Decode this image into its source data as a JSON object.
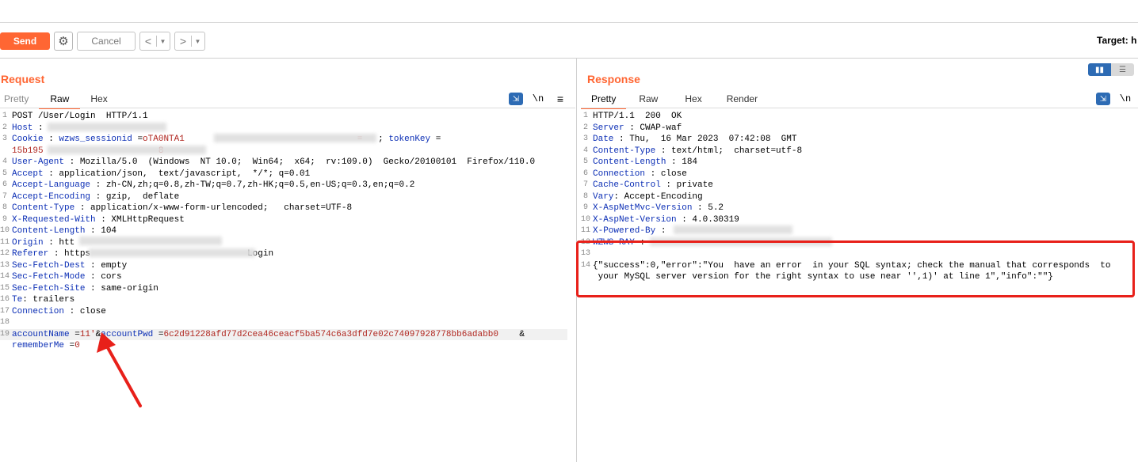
{
  "toolbar": {
    "send_label": "Send",
    "cancel_label": "Cancel",
    "target_label": "Target: h"
  },
  "request": {
    "title": "Request",
    "tabs": [
      "Pretty",
      "Raw",
      "Hex"
    ],
    "lines": [
      {
        "n": "1",
        "segs": [
          {
            "t": "POST /User/Login  HTTP/1.1",
            "c": "hval"
          }
        ]
      },
      {
        "n": "2",
        "segs": [
          {
            "t": "Host",
            "c": "hname"
          },
          {
            "t": " : ",
            "c": "hval"
          }
        ]
      },
      {
        "n": "3",
        "segs": [
          {
            "t": "Cookie",
            "c": "hname"
          },
          {
            "t": " : ",
            "c": "hval"
          },
          {
            "t": "wzws_sessionid",
            "c": "hname"
          },
          {
            "t": " =",
            "c": "hval"
          },
          {
            "t": "oTA0NTA1",
            "c": "param-val"
          },
          {
            "t": "                                 ",
            "c": "hval"
          },
          {
            "t": "=",
            "c": "param-val"
          },
          {
            "t": "   ; ",
            "c": "hval"
          },
          {
            "t": "tokenKey",
            "c": "hname"
          },
          {
            "t": " =",
            "c": "hval"
          }
        ]
      },
      {
        "n": "",
        "segs": [
          {
            "t": "15b195",
            "c": "param-val"
          },
          {
            "t": "                      ",
            "c": "hval"
          },
          {
            "t": "8",
            "c": "param-val"
          }
        ]
      },
      {
        "n": "4",
        "segs": [
          {
            "t": "User-Agent",
            "c": "hname"
          },
          {
            "t": " : Mozilla/5.0  (Windows  NT 10.0;  Win64;  x64;  rv:109.0)  Gecko/20100101  Firefox/110.0",
            "c": "hval"
          }
        ]
      },
      {
        "n": "5",
        "segs": [
          {
            "t": "Accept",
            "c": "hname"
          },
          {
            "t": " : application/json,  text/javascript,  */*; q=0.01",
            "c": "hval"
          }
        ]
      },
      {
        "n": "6",
        "segs": [
          {
            "t": "Accept-Language",
            "c": "hname"
          },
          {
            "t": " : zh-CN,zh;q=0.8,zh-TW;q=0.7,zh-HK;q=0.5,en-US;q=0.3,en;q=0.2",
            "c": "hval"
          }
        ]
      },
      {
        "n": "7",
        "segs": [
          {
            "t": "Accept-Encoding",
            "c": "hname"
          },
          {
            "t": " : gzip,  deflate",
            "c": "hval"
          }
        ]
      },
      {
        "n": "8",
        "segs": [
          {
            "t": "Content-Type",
            "c": "hname"
          },
          {
            "t": " : application/x-www-form-urlencoded;   charset=UTF-8",
            "c": "hval"
          }
        ]
      },
      {
        "n": "9",
        "segs": [
          {
            "t": "X-Requested-With",
            "c": "hname"
          },
          {
            "t": " : XMLHttpRequest",
            "c": "hval"
          }
        ]
      },
      {
        "n": "10",
        "segs": [
          {
            "t": "Content-Length",
            "c": "hname"
          },
          {
            "t": " : 104",
            "c": "hval"
          }
        ]
      },
      {
        "n": "11",
        "segs": [
          {
            "t": "Origin",
            "c": "hname"
          },
          {
            "t": " : htt",
            "c": "hval"
          }
        ]
      },
      {
        "n": "12",
        "segs": [
          {
            "t": "Referer",
            "c": "hname"
          },
          {
            "t": " : https",
            "c": "hval"
          },
          {
            "t": "                              ",
            "c": "hval"
          },
          {
            "t": "Login",
            "c": "hval"
          }
        ]
      },
      {
        "n": "13",
        "segs": [
          {
            "t": "Sec-Fetch-Dest",
            "c": "hname"
          },
          {
            "t": " : empty",
            "c": "hval"
          }
        ]
      },
      {
        "n": "14",
        "segs": [
          {
            "t": "Sec-Fetch-Mode",
            "c": "hname"
          },
          {
            "t": " : cors",
            "c": "hval"
          }
        ]
      },
      {
        "n": "15",
        "segs": [
          {
            "t": "Sec-Fetch-Site",
            "c": "hname"
          },
          {
            "t": " : same-origin",
            "c": "hval"
          }
        ]
      },
      {
        "n": "16",
        "segs": [
          {
            "t": "Te",
            "c": "hname"
          },
          {
            "t": ": trailers",
            "c": "hval"
          }
        ]
      },
      {
        "n": "17",
        "segs": [
          {
            "t": "Connection",
            "c": "hname"
          },
          {
            "t": " : close",
            "c": "hval"
          }
        ]
      },
      {
        "n": "18",
        "segs": []
      },
      {
        "n": "19",
        "hl": true,
        "segs": [
          {
            "t": "accountName",
            "c": "param-name"
          },
          {
            "t": " =",
            "c": "hval"
          },
          {
            "t": "11'",
            "c": "param-val"
          },
          {
            "t": "&",
            "c": "hval"
          },
          {
            "t": "accountPwd",
            "c": "param-name"
          },
          {
            "t": " =",
            "c": "hval"
          },
          {
            "t": "6c2d91228afd77d2cea46ceacf5ba574c6a3dfd7e02c74097928778bb6adabb0",
            "c": "param-val"
          },
          {
            "t": "    &",
            "c": "hval"
          }
        ]
      },
      {
        "n": "",
        "segs": [
          {
            "t": "rememberMe",
            "c": "param-name"
          },
          {
            "t": " =",
            "c": "hval"
          },
          {
            "t": "0",
            "c": "param-val"
          }
        ]
      }
    ]
  },
  "response": {
    "title": "Response",
    "tabs": [
      "Pretty",
      "Raw",
      "Hex",
      "Render"
    ],
    "lines": [
      {
        "n": "1",
        "segs": [
          {
            "t": "HTTP/1.1  200  OK",
            "c": "hval"
          }
        ]
      },
      {
        "n": "2",
        "segs": [
          {
            "t": "Server",
            "c": "hname"
          },
          {
            "t": " : CWAP-waf",
            "c": "hval"
          }
        ]
      },
      {
        "n": "3",
        "segs": [
          {
            "t": "Date",
            "c": "hname"
          },
          {
            "t": " : Thu,  16 Mar 2023  07:42:08  GMT",
            "c": "hval"
          }
        ]
      },
      {
        "n": "4",
        "segs": [
          {
            "t": "Content-Type",
            "c": "hname"
          },
          {
            "t": " : text/html;  charset=utf-8",
            "c": "hval"
          }
        ]
      },
      {
        "n": "5",
        "segs": [
          {
            "t": "Content-Length",
            "c": "hname"
          },
          {
            "t": " : 184",
            "c": "hval"
          }
        ]
      },
      {
        "n": "6",
        "segs": [
          {
            "t": "Connection",
            "c": "hname"
          },
          {
            "t": " : close",
            "c": "hval"
          }
        ]
      },
      {
        "n": "7",
        "segs": [
          {
            "t": "Cache-Control",
            "c": "hname"
          },
          {
            "t": " : private",
            "c": "hval"
          }
        ]
      },
      {
        "n": "8",
        "segs": [
          {
            "t": "Vary",
            "c": "hname"
          },
          {
            "t": ": Accept-Encoding",
            "c": "hval"
          }
        ]
      },
      {
        "n": "9",
        "segs": [
          {
            "t": "X-AspNetMvc-Version",
            "c": "hname"
          },
          {
            "t": " : 5.2",
            "c": "hval"
          }
        ]
      },
      {
        "n": "10",
        "segs": [
          {
            "t": "X-AspNet-Version",
            "c": "hname"
          },
          {
            "t": " : 4.0.30319",
            "c": "hval"
          }
        ]
      },
      {
        "n": "11",
        "segs": [
          {
            "t": "X-Powered-By",
            "c": "hname"
          },
          {
            "t": " : ",
            "c": "hval"
          }
        ]
      },
      {
        "n": "12",
        "segs": [
          {
            "t": "WZWS-RAY",
            "c": "hname"
          },
          {
            "t": " : ",
            "c": "hval"
          }
        ]
      },
      {
        "n": "13",
        "segs": []
      },
      {
        "n": "14",
        "segs": [
          {
            "t": "{\"success\":0,\"error\":\"You  have an error  in your SQL syntax; check the manual that corresponds  to",
            "c": "hval"
          }
        ]
      },
      {
        "n": "",
        "segs": [
          {
            "t": " your MySQL server version for the right syntax to use near '',1)' at line 1\",\"info\":\"\"}",
            "c": "hval"
          }
        ]
      }
    ]
  },
  "colors": {
    "accent": "#ff6633",
    "header_name": "#0b2eb5",
    "param_value": "#b0261f",
    "highlight_box": "#e8201a"
  },
  "icons": {
    "settings": "gear-icon",
    "back": "chevron-left-icon",
    "forward": "chevron-right-icon",
    "wrap": "word-wrap-icon",
    "newline": "newline-icon",
    "menu": "hamburger-menu-icon",
    "layout": "layout-toggle-icon"
  }
}
